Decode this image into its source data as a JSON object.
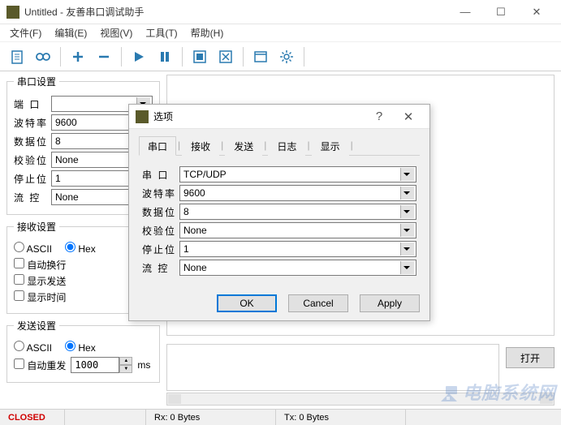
{
  "window": {
    "title": "Untitled - 友善串口调试助手"
  },
  "menu": {
    "file": "文件(F)",
    "edit": "编辑(E)",
    "view": "视图(V)",
    "tools": "工具(T)",
    "help": "帮助(H)"
  },
  "sidebar": {
    "group_serial": "串口设置",
    "port_label": "端 口",
    "port_value": "",
    "baud_label": "波特率",
    "baud_value": "9600",
    "databits_label": "数据位",
    "databits_value": "8",
    "parity_label": "校验位",
    "parity_value": "None",
    "stopbits_label": "停止位",
    "stopbits_value": "1",
    "flow_label": "流 控",
    "flow_value": "None",
    "group_recv": "接收设置",
    "recv_ascii": "ASCII",
    "recv_hex": "Hex",
    "auto_wrap": "自动换行",
    "show_send": "显示发送",
    "show_time": "显示时间",
    "group_send": "发送设置",
    "send_ascii": "ASCII",
    "send_hex": "Hex",
    "auto_resend": "自动重发",
    "resend_value": "1000",
    "ms_label": "ms"
  },
  "buttons": {
    "open": "打开"
  },
  "statusbar": {
    "closed": "CLOSED",
    "rx": "Rx: 0 Bytes",
    "tx": "Tx: 0 Bytes"
  },
  "modal": {
    "title": "选项",
    "tabs": {
      "serial": "串口",
      "recv": "接收",
      "send": "发送",
      "log": "日志",
      "display": "显示"
    },
    "port_label": "串 口",
    "port_value": "TCP/UDP",
    "baud_label": "波特率",
    "baud_value": "9600",
    "databits_label": "数据位",
    "databits_value": "8",
    "parity_label": "校验位",
    "parity_value": "None",
    "stopbits_label": "停止位",
    "stopbits_value": "1",
    "flow_label": "流 控",
    "flow_value": "None",
    "ok": "OK",
    "cancel": "Cancel",
    "apply": "Apply"
  },
  "watermark": "电脑系统网"
}
